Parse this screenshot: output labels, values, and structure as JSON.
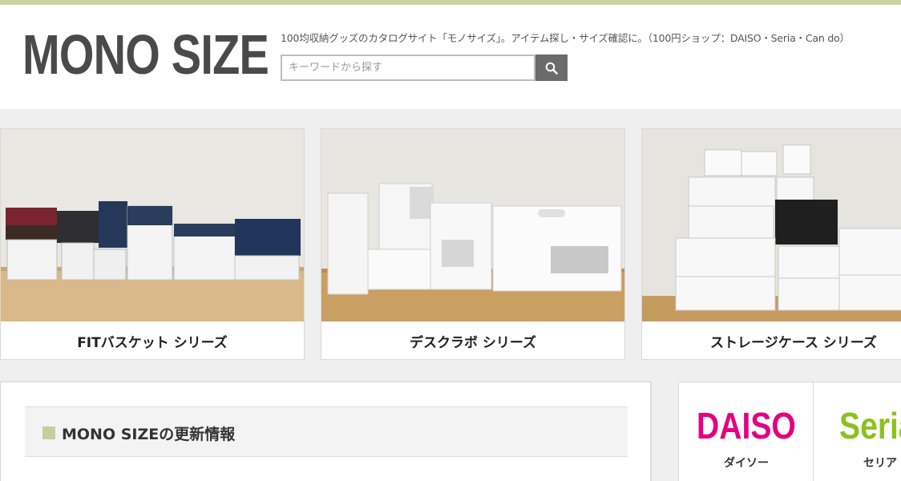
{
  "site": {
    "logo_text": "MONO SIZE",
    "tagline": "100均収納グッズのカタログサイト「モノサイズ」。アイテム探し・サイズ確認に。（100円ショップ：DAISO・Seria・Can do）"
  },
  "search": {
    "placeholder": "キーワードから探す",
    "value": "",
    "button_icon": "search-icon"
  },
  "series_cards": [
    {
      "label": "FITバスケット シリーズ",
      "image_subject": "stacked plastic baskets"
    },
    {
      "label": "デスクラボ シリーズ",
      "image_subject": "white desk organizers"
    },
    {
      "label": "ストレージケース シリーズ",
      "image_subject": "stacked white storage cases"
    }
  ],
  "news": {
    "title": "MONO SIZEの更新情報"
  },
  "shops": [
    {
      "logo": "DAISO",
      "kana": "ダイソー",
      "color": "#e4007f"
    },
    {
      "logo": "Seria",
      "kana": "セリア",
      "color": "#8cc11f"
    }
  ],
  "colors": {
    "top_bar": "#c8d3a0",
    "search_button": "#6b6b6b",
    "page_background": "#efefef",
    "news_accent": "#c2d0a0"
  }
}
